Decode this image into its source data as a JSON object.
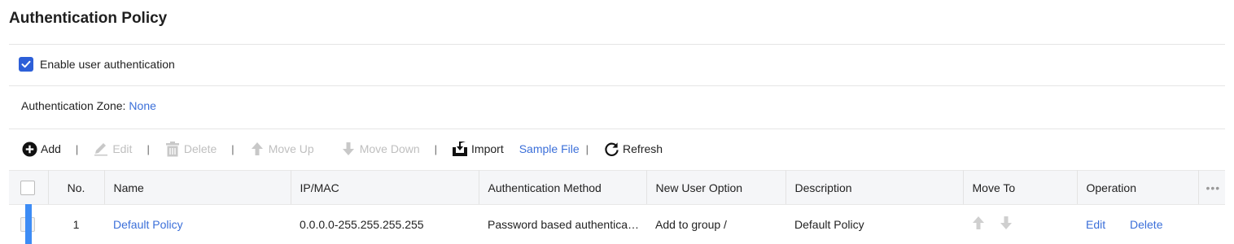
{
  "page": {
    "title": "Authentication Policy"
  },
  "settings": {
    "enable_label": "Enable user authentication",
    "zone_label": "Authentication Zone:",
    "zone_value": "None"
  },
  "toolbar": {
    "add": "Add",
    "edit": "Edit",
    "delete": "Delete",
    "move_up": "Move Up",
    "move_down": "Move Down",
    "import": "Import",
    "sample_file": "Sample File",
    "refresh": "Refresh",
    "separator": "|"
  },
  "table": {
    "columns": [
      "No.",
      "Name",
      "IP/MAC",
      "Authentication Method",
      "New User Option",
      "Description",
      "Move To",
      "Operation"
    ],
    "more": "•••",
    "rows": [
      {
        "no": "1",
        "name": "Default Policy",
        "ip_mac": "0.0.0.0-255.255.255.255",
        "method": "Password based authentication",
        "new_user_option": "Add to group /",
        "description": "Default Policy",
        "edit": "Edit",
        "delete": "Delete"
      }
    ]
  },
  "colors": {
    "accent": "#2d5fd8",
    "link": "#3b6fd9",
    "disabled": "#bfbfbf",
    "row_marker": "#3d8cf5"
  }
}
